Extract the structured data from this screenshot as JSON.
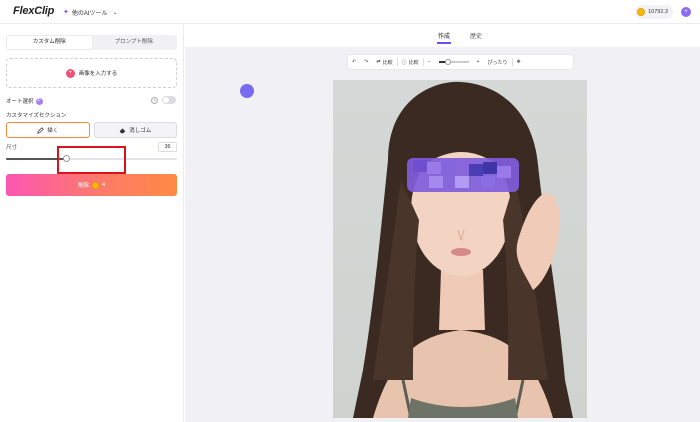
{
  "app": {
    "logo": "FlexClip",
    "ai_tools_menu": "他のAIツール"
  },
  "account": {
    "credits": "10792.3",
    "avatar_initial": "+"
  },
  "left_panel": {
    "tabs": [
      {
        "label": "カスタム削除",
        "active": true
      },
      {
        "label": "プロンプト削除",
        "active": false
      }
    ],
    "upload_label": "画像を入力する",
    "auto_select": {
      "label": "オート選択",
      "badge": "P",
      "help": "?",
      "enabled": false
    },
    "custom_section_label": "カスタマイズセクション",
    "modes": [
      {
        "label": "描く",
        "icon": "pencil-icon",
        "active": true
      },
      {
        "label": "消しゴム",
        "icon": "eraser-icon",
        "active": false
      }
    ],
    "size": {
      "label": "尺寸",
      "value": "36",
      "slider_fraction": 0.35
    },
    "delete_button": {
      "label": "削除",
      "cost": "4"
    }
  },
  "main": {
    "tabs": [
      {
        "label": "作成",
        "active": true
      },
      {
        "label": "歴史",
        "active": false
      }
    ],
    "toolbar": {
      "undo_icon": "↶",
      "redo_icon": "↷",
      "compare_label": "比較",
      "compare_btn": "比較",
      "zoom_out": "−",
      "zoom_in": "+",
      "fit_label": "ぴったり",
      "move_icon": "✥"
    }
  },
  "colors": {
    "accent": "#6d4cf6",
    "delete_gradient_start": "#fb56b2",
    "delete_gradient_end": "#ff8a44",
    "highlight": "#d9131b"
  }
}
